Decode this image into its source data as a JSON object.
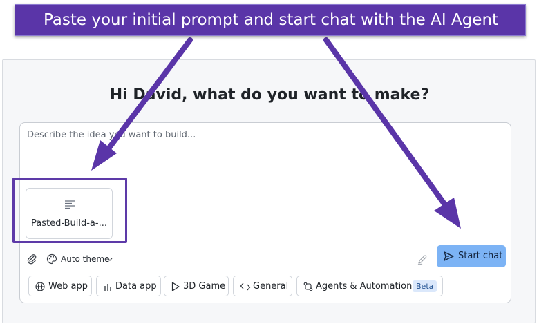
{
  "banner": {
    "text": "Paste your initial prompt and start chat with the AI Agent"
  },
  "heading": "Hi David, what do you want to make?",
  "prompt": {
    "placeholder": "Describe the idea you want to build...",
    "value": ""
  },
  "attachment": {
    "name": "Pasted-Build-a-...",
    "icon": "document-lines-icon"
  },
  "toolbar": {
    "attach_icon": "paperclip-icon",
    "theme_icon": "palette-icon",
    "theme_label": "Auto theme",
    "pen_icon": "pen-icon",
    "start_label": "Start chat",
    "start_color": "#7cb3f5"
  },
  "templates": [
    {
      "label": "Web app",
      "icon": "globe-icon"
    },
    {
      "label": "Data app",
      "icon": "bar-chart-icon"
    },
    {
      "label": "3D Game",
      "icon": "play-triangle-icon"
    },
    {
      "label": "General",
      "icon": "code-arrows-icon"
    },
    {
      "label": "Agents & Automations",
      "icon": "workflow-icon",
      "badge": "Beta"
    }
  ],
  "colors": {
    "annotation_purple": "#5a35a8",
    "badge_bg": "#dbe8fb"
  }
}
